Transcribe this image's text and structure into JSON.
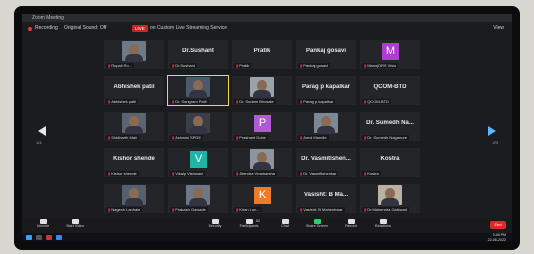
{
  "window": {
    "title": "Zoom Meeting",
    "view_label": "View"
  },
  "strip": {
    "recording": "Recording",
    "original_sound": "Original Sound: Off",
    "live_badge": "LIVE",
    "streaming": "on Custom Live Streaming Service"
  },
  "tiles": [
    {
      "center": "",
      "tag": "Rupali Ro...",
      "kind": "photo",
      "color": "#6e7a86"
    },
    {
      "center": "Dr.Sushant",
      "tag": "Dr.Sushant",
      "kind": "none"
    },
    {
      "center": "Pratik",
      "tag": "Pratik",
      "kind": "none"
    },
    {
      "center": "Pankaj gosavi",
      "tag": "Pankaj gosavi",
      "kind": "none"
    },
    {
      "center": "",
      "tag": "ManojDRS Visio",
      "kind": "avatar",
      "letter": "M",
      "color": "#b13bd3"
    },
    {
      "center": "Abhishek patil",
      "tag": "Abhishek patil",
      "kind": "none"
    },
    {
      "center": "",
      "tag": "Dr. Sangram Patil",
      "kind": "photo",
      "color": "#4b5a6a",
      "active": true
    },
    {
      "center": "",
      "tag": "Dr. Sudam Bhosale",
      "kind": "photo",
      "color": "#9aa3ab"
    },
    {
      "center": "Parag p kapalkar",
      "tag": "Parag p kapalkar",
      "kind": "none"
    },
    {
      "center": "QCOM-BTD",
      "tag": "QCOM-BTD",
      "kind": "none"
    },
    {
      "center": "",
      "tag": "Siddharth Mali",
      "kind": "photo",
      "color": "#5b6470"
    },
    {
      "center": "",
      "tag": "Ashwini SPDE",
      "kind": "photo",
      "color": "#3a3f47"
    },
    {
      "center": "",
      "tag": "Prashant Dube",
      "kind": "avatar",
      "letter": "P",
      "color": "#b05ad6"
    },
    {
      "center": "",
      "tag": "Amol Mandle",
      "kind": "photo",
      "color": "#7c8894"
    },
    {
      "center": "Dr. Sumedh Na...",
      "tag": "Dr. Sumedh Naganure",
      "kind": "none"
    },
    {
      "center": "Kishor shende",
      "tag": "Kishor shende",
      "kind": "none"
    },
    {
      "center": "",
      "tag": "Vikalp Vishwasi",
      "kind": "avatar",
      "letter": "V",
      "color": "#1fb5a6"
    },
    {
      "center": "",
      "tag": "Jitendra Vmaharsha",
      "kind": "photo",
      "color": "#8d96a0"
    },
    {
      "center": "Dr. Vasmitlshen...",
      "tag": "Dr. Vasmitlshenkar",
      "kind": "none"
    },
    {
      "center": "Kostra",
      "tag": "Kostra",
      "kind": "none"
    },
    {
      "center": "",
      "tag": "Nagesh Lanhale",
      "kind": "photo",
      "color": "#56606c"
    },
    {
      "center": "",
      "tag": "Prakash Gawade",
      "kind": "photo",
      "color": "#6d7785"
    },
    {
      "center": "",
      "tag": "Kiran Lon...",
      "kind": "avatar",
      "letter": "K",
      "color": "#f07a26"
    },
    {
      "center": "Vasisht: B Ma...",
      "tag": "Vasisht: B Maheshwar",
      "kind": "none"
    },
    {
      "center": "",
      "tag": "Dr.Mahendra Gaikwad",
      "kind": "photo",
      "color": "#b8b1a4"
    }
  ],
  "pager": {
    "left": "1/4",
    "right": "2/3"
  },
  "toolbar": {
    "items": [
      {
        "label": "Unmute"
      },
      {
        "label": "Start Video"
      },
      {
        "label": "Security"
      },
      {
        "label": "Participants",
        "count": "52"
      },
      {
        "label": "Chat"
      },
      {
        "label": "Share Screen"
      },
      {
        "label": "Record"
      },
      {
        "label": "Reactions"
      }
    ],
    "end_label": "End"
  },
  "clock": {
    "time": "3:48 PM",
    "date": "22-06-2022"
  },
  "colors": {
    "accent": "#5bb8ff",
    "end": "#e02828",
    "live": "#c62828"
  }
}
